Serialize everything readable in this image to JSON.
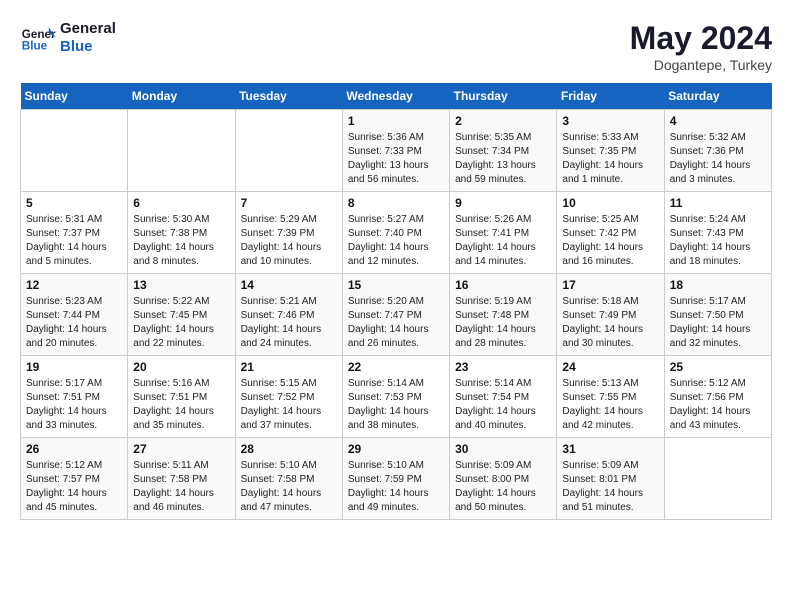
{
  "header": {
    "logo_general": "General",
    "logo_blue": "Blue",
    "month": "May 2024",
    "location": "Dogantepe, Turkey"
  },
  "weekdays": [
    "Sunday",
    "Monday",
    "Tuesday",
    "Wednesday",
    "Thursday",
    "Friday",
    "Saturday"
  ],
  "weeks": [
    [
      {
        "day": "",
        "info": ""
      },
      {
        "day": "",
        "info": ""
      },
      {
        "day": "",
        "info": ""
      },
      {
        "day": "1",
        "info": "Sunrise: 5:36 AM\nSunset: 7:33 PM\nDaylight: 13 hours and 56 minutes."
      },
      {
        "day": "2",
        "info": "Sunrise: 5:35 AM\nSunset: 7:34 PM\nDaylight: 13 hours and 59 minutes."
      },
      {
        "day": "3",
        "info": "Sunrise: 5:33 AM\nSunset: 7:35 PM\nDaylight: 14 hours and 1 minute."
      },
      {
        "day": "4",
        "info": "Sunrise: 5:32 AM\nSunset: 7:36 PM\nDaylight: 14 hours and 3 minutes."
      }
    ],
    [
      {
        "day": "5",
        "info": "Sunrise: 5:31 AM\nSunset: 7:37 PM\nDaylight: 14 hours and 5 minutes."
      },
      {
        "day": "6",
        "info": "Sunrise: 5:30 AM\nSunset: 7:38 PM\nDaylight: 14 hours and 8 minutes."
      },
      {
        "day": "7",
        "info": "Sunrise: 5:29 AM\nSunset: 7:39 PM\nDaylight: 14 hours and 10 minutes."
      },
      {
        "day": "8",
        "info": "Sunrise: 5:27 AM\nSunset: 7:40 PM\nDaylight: 14 hours and 12 minutes."
      },
      {
        "day": "9",
        "info": "Sunrise: 5:26 AM\nSunset: 7:41 PM\nDaylight: 14 hours and 14 minutes."
      },
      {
        "day": "10",
        "info": "Sunrise: 5:25 AM\nSunset: 7:42 PM\nDaylight: 14 hours and 16 minutes."
      },
      {
        "day": "11",
        "info": "Sunrise: 5:24 AM\nSunset: 7:43 PM\nDaylight: 14 hours and 18 minutes."
      }
    ],
    [
      {
        "day": "12",
        "info": "Sunrise: 5:23 AM\nSunset: 7:44 PM\nDaylight: 14 hours and 20 minutes."
      },
      {
        "day": "13",
        "info": "Sunrise: 5:22 AM\nSunset: 7:45 PM\nDaylight: 14 hours and 22 minutes."
      },
      {
        "day": "14",
        "info": "Sunrise: 5:21 AM\nSunset: 7:46 PM\nDaylight: 14 hours and 24 minutes."
      },
      {
        "day": "15",
        "info": "Sunrise: 5:20 AM\nSunset: 7:47 PM\nDaylight: 14 hours and 26 minutes."
      },
      {
        "day": "16",
        "info": "Sunrise: 5:19 AM\nSunset: 7:48 PM\nDaylight: 14 hours and 28 minutes."
      },
      {
        "day": "17",
        "info": "Sunrise: 5:18 AM\nSunset: 7:49 PM\nDaylight: 14 hours and 30 minutes."
      },
      {
        "day": "18",
        "info": "Sunrise: 5:17 AM\nSunset: 7:50 PM\nDaylight: 14 hours and 32 minutes."
      }
    ],
    [
      {
        "day": "19",
        "info": "Sunrise: 5:17 AM\nSunset: 7:51 PM\nDaylight: 14 hours and 33 minutes."
      },
      {
        "day": "20",
        "info": "Sunrise: 5:16 AM\nSunset: 7:51 PM\nDaylight: 14 hours and 35 minutes."
      },
      {
        "day": "21",
        "info": "Sunrise: 5:15 AM\nSunset: 7:52 PM\nDaylight: 14 hours and 37 minutes."
      },
      {
        "day": "22",
        "info": "Sunrise: 5:14 AM\nSunset: 7:53 PM\nDaylight: 14 hours and 38 minutes."
      },
      {
        "day": "23",
        "info": "Sunrise: 5:14 AM\nSunset: 7:54 PM\nDaylight: 14 hours and 40 minutes."
      },
      {
        "day": "24",
        "info": "Sunrise: 5:13 AM\nSunset: 7:55 PM\nDaylight: 14 hours and 42 minutes."
      },
      {
        "day": "25",
        "info": "Sunrise: 5:12 AM\nSunset: 7:56 PM\nDaylight: 14 hours and 43 minutes."
      }
    ],
    [
      {
        "day": "26",
        "info": "Sunrise: 5:12 AM\nSunset: 7:57 PM\nDaylight: 14 hours and 45 minutes."
      },
      {
        "day": "27",
        "info": "Sunrise: 5:11 AM\nSunset: 7:58 PM\nDaylight: 14 hours and 46 minutes."
      },
      {
        "day": "28",
        "info": "Sunrise: 5:10 AM\nSunset: 7:58 PM\nDaylight: 14 hours and 47 minutes."
      },
      {
        "day": "29",
        "info": "Sunrise: 5:10 AM\nSunset: 7:59 PM\nDaylight: 14 hours and 49 minutes."
      },
      {
        "day": "30",
        "info": "Sunrise: 5:09 AM\nSunset: 8:00 PM\nDaylight: 14 hours and 50 minutes."
      },
      {
        "day": "31",
        "info": "Sunrise: 5:09 AM\nSunset: 8:01 PM\nDaylight: 14 hours and 51 minutes."
      },
      {
        "day": "",
        "info": ""
      }
    ]
  ]
}
